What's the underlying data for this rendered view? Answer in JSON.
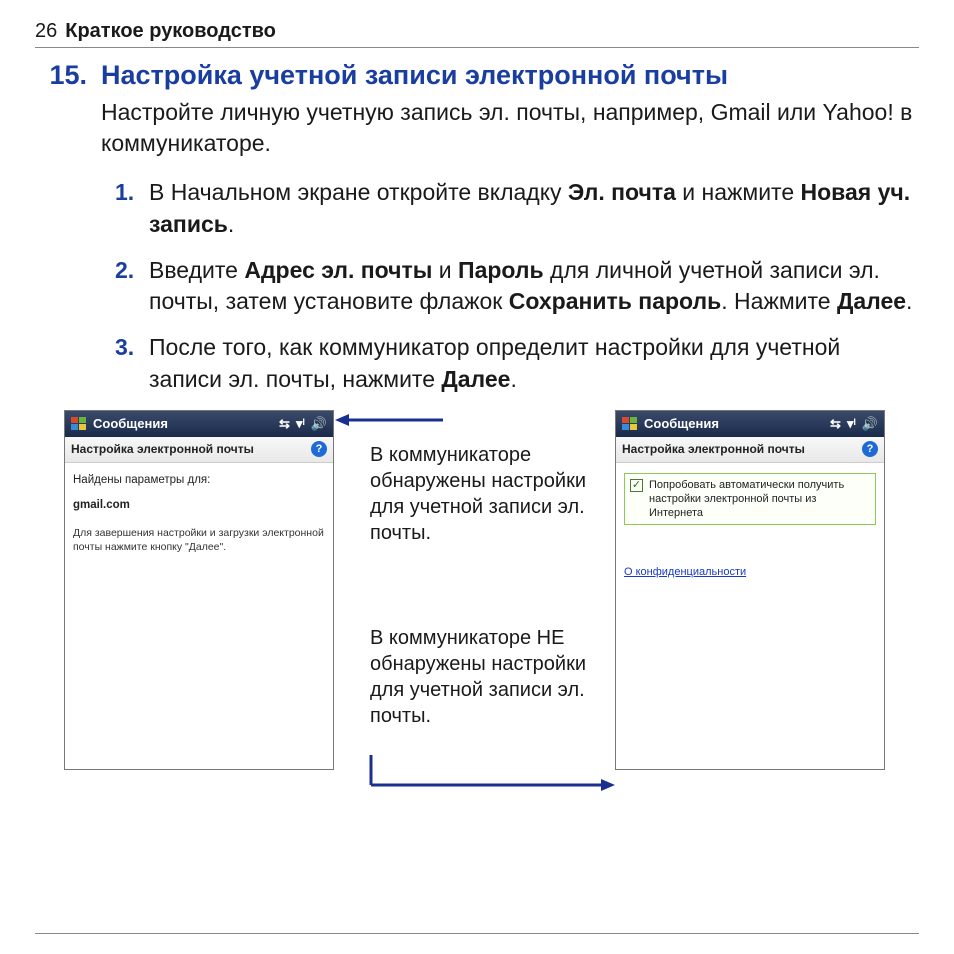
{
  "header": {
    "page_number": "26",
    "guide_title": "Краткое руководство"
  },
  "section": {
    "number": "15.",
    "title": "Настройка учетной записи электронной почты",
    "intro": "Настройте личную учетную запись эл. почты, например, Gmail или Yahoo!  в коммуникаторе."
  },
  "steps": {
    "s1": {
      "num": "1.",
      "pre": "В Начальном экране откройте вкладку ",
      "b1": "Эл. почта",
      "mid": " и нажмите ",
      "b2": "Новая уч. запись",
      "post": "."
    },
    "s2": {
      "num": "2.",
      "pre": "Введите ",
      "b1": "Адрес эл. почты",
      "mid1": " и ",
      "b2": "Пароль",
      "mid2": " для личной учетной записи эл. почты, затем установите флажок ",
      "b3": "Сохранить пароль",
      "mid3": ". Нажмите ",
      "b4": "Далее",
      "post": "."
    },
    "s3": {
      "num": "3.",
      "pre": "После того, как коммуникатор определит настройки для учетной записи эл. почты, нажмите ",
      "b1": "Далее",
      "post": "."
    }
  },
  "phone_left": {
    "titlebar": "Сообщения",
    "subheader": "Настройка электронной почты",
    "found_label": "Найдены параметры для:",
    "domain": "gmail.com",
    "instruction": "Для завершения настройки и загрузки электронной почты нажмите кнопку \"Далее\"."
  },
  "phone_right": {
    "titlebar": "Сообщения",
    "subheader": "Настройка электронной почты",
    "checkbox_label": "Попробовать автоматически получить настройки электронной почты из Интернета",
    "privacy": "О конфиденциальности"
  },
  "annotations": {
    "found": "В коммуникаторе обнаружены настройки для учетной записи эл. почты.",
    "not_found": "В коммуникаторе НЕ обнаружены настройки для учетной записи эл. почты."
  },
  "icons": {
    "help": "?",
    "check": "✓"
  }
}
